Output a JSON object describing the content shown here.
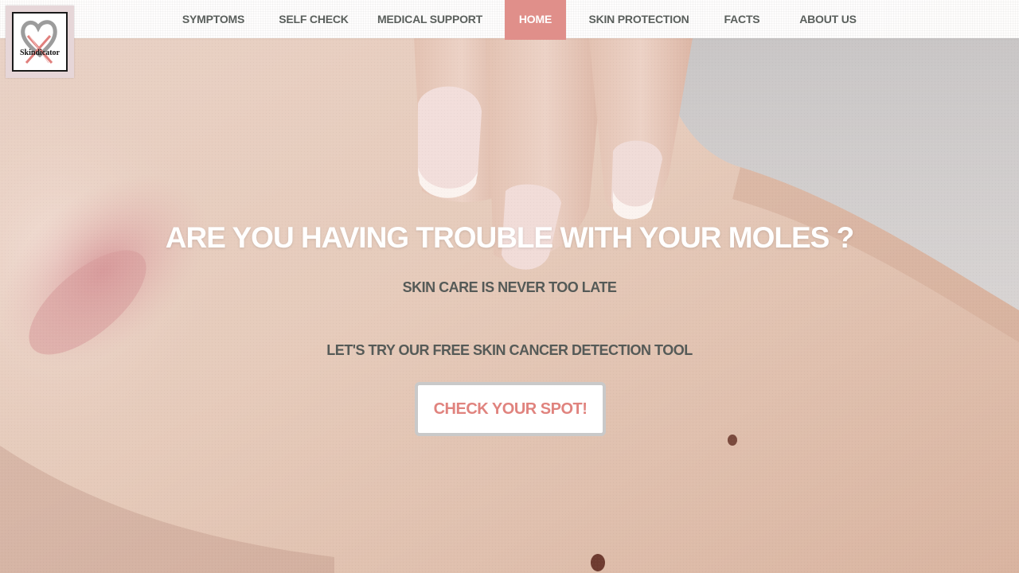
{
  "logo": {
    "text": "Skindicator",
    "icon": "heart-ribbon-cross-icon"
  },
  "nav": {
    "items": [
      {
        "label": "SYMPTOMS",
        "active": false
      },
      {
        "label": "SELF CHECK",
        "active": false
      },
      {
        "label": "MEDICAL SUPPORT",
        "active": false
      },
      {
        "label": "HOME",
        "active": true
      },
      {
        "label": "SKIN PROTECTION",
        "active": false
      },
      {
        "label": "FACTS",
        "active": false
      },
      {
        "label": "ABOUT US",
        "active": false
      }
    ]
  },
  "hero": {
    "title": "ARE YOU HAVING TROUBLE WITH YOUR MOLES ?",
    "subtitle": "SKIN CARE IS NEVER TOO LATE",
    "tagline": "LET'S TRY OUR FREE SKIN CANCER DETECTION TOOL",
    "cta_label": "CHECK YOUR SPOT!"
  },
  "colors": {
    "accent": "#e08f8a",
    "nav_text": "#5a5f5c",
    "cta_text": "#e0837e",
    "hero_text": "#ffffff",
    "body_text": "#555a57"
  }
}
